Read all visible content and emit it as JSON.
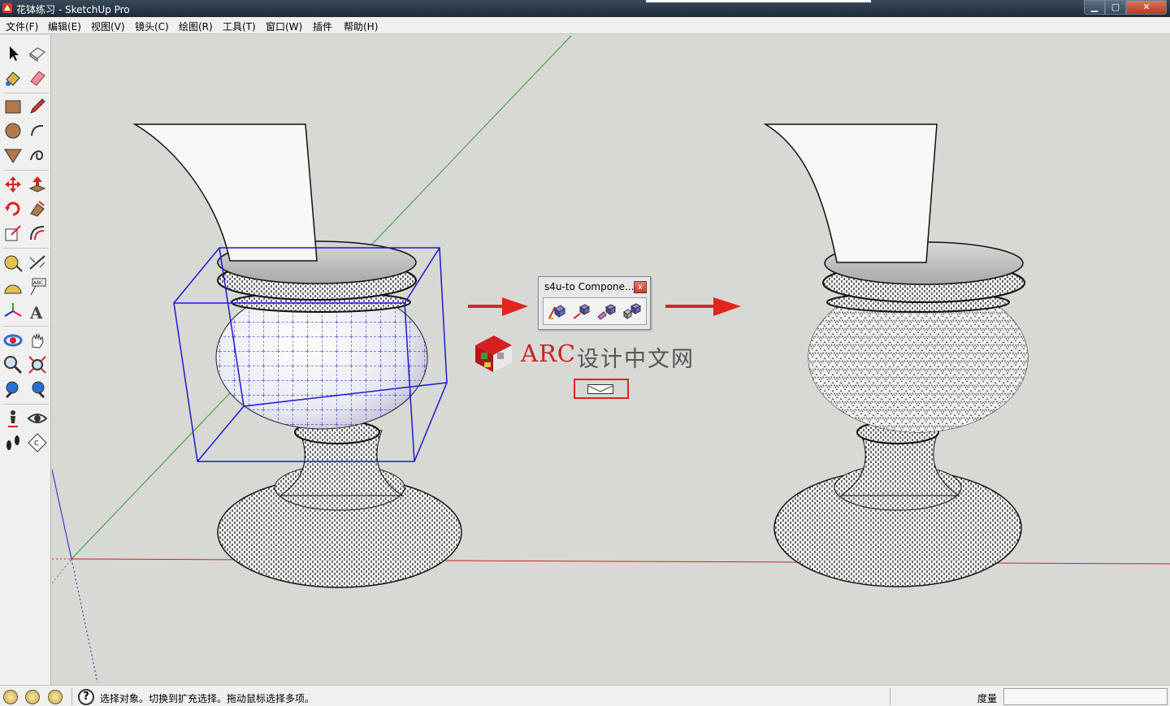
{
  "window": {
    "title": "花钵练习 - SketchUp Pro",
    "min_label": "▁",
    "max_label": "▢",
    "close_label": "✕"
  },
  "menu": {
    "items": [
      "文件(F)",
      "编辑(E)",
      "视图(V)",
      "镜头(C)",
      "绘图(R)",
      "工具(T)",
      "窗口(W)",
      "插件",
      "帮助(H)"
    ]
  },
  "toolbar": {
    "tools": [
      "select-tool",
      "make-component-tool",
      "paint-bucket-tool",
      "eraser-tool",
      "rectangle-tool",
      "line-tool",
      "circle-tool",
      "arc-tool",
      "polygon-tool",
      "freehand-tool",
      "move-tool",
      "push-pull-tool",
      "rotate-tool",
      "follow-me-tool",
      "scale-tool",
      "offset-tool",
      "tape-measure-tool",
      "dimension-tool",
      "protractor-tool",
      "text-tool",
      "axes-tool",
      "3d-text-tool",
      "orbit-tool",
      "pan-tool",
      "zoom-tool",
      "zoom-extents-tool",
      "previous-view-tool",
      "next-view-tool",
      "position-camera-tool",
      "look-around-tool",
      "walk-tool",
      "section-plane-tool"
    ]
  },
  "s4u_panel": {
    "title": "s4u-to Compone...",
    "close_label": "x",
    "buttons": [
      "s4u-component-icon-1",
      "s4u-component-icon-2",
      "s4u-component-icon-3",
      "s4u-component-icon-4"
    ]
  },
  "watermark": {
    "brand": "ARC",
    "text": "设计中文网"
  },
  "statusbar": {
    "help_label": "?",
    "message": "选择对象。切换到扩充选择。拖动鼠标选择多项。",
    "measure_label": "度量",
    "measure_value": ""
  },
  "colors": {
    "accent_red": "#e3231e",
    "selection_blue": "#1a1ad6",
    "axis_green": "#2aa02a",
    "axis_red": "#d42020"
  }
}
